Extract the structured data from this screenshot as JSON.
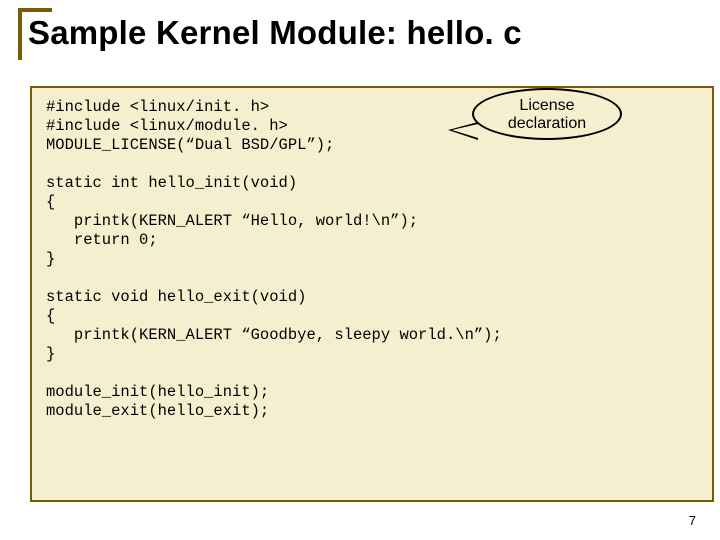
{
  "slide": {
    "title": "Sample Kernel Module: hello. c",
    "page_number": "7"
  },
  "callout": {
    "line1": "License",
    "line2": "declaration"
  },
  "code": {
    "l01": "#include <linux/init. h>",
    "l02": "#include <linux/module. h>",
    "l03": "MODULE_LICENSE(“Dual BSD/GPL”);",
    "l04": "",
    "l05": "static int hello_init(void)",
    "l06": "{",
    "l07": "   printk(KERN_ALERT “Hello, world!\\n”);",
    "l08": "   return 0;",
    "l09": "}",
    "l10": "",
    "l11": "static void hello_exit(void)",
    "l12": "{",
    "l13": "   printk(KERN_ALERT “Goodbye, sleepy world.\\n”);",
    "l14": "}",
    "l15": "",
    "l16": "module_init(hello_init);",
    "l17": "module_exit(hello_exit);"
  }
}
